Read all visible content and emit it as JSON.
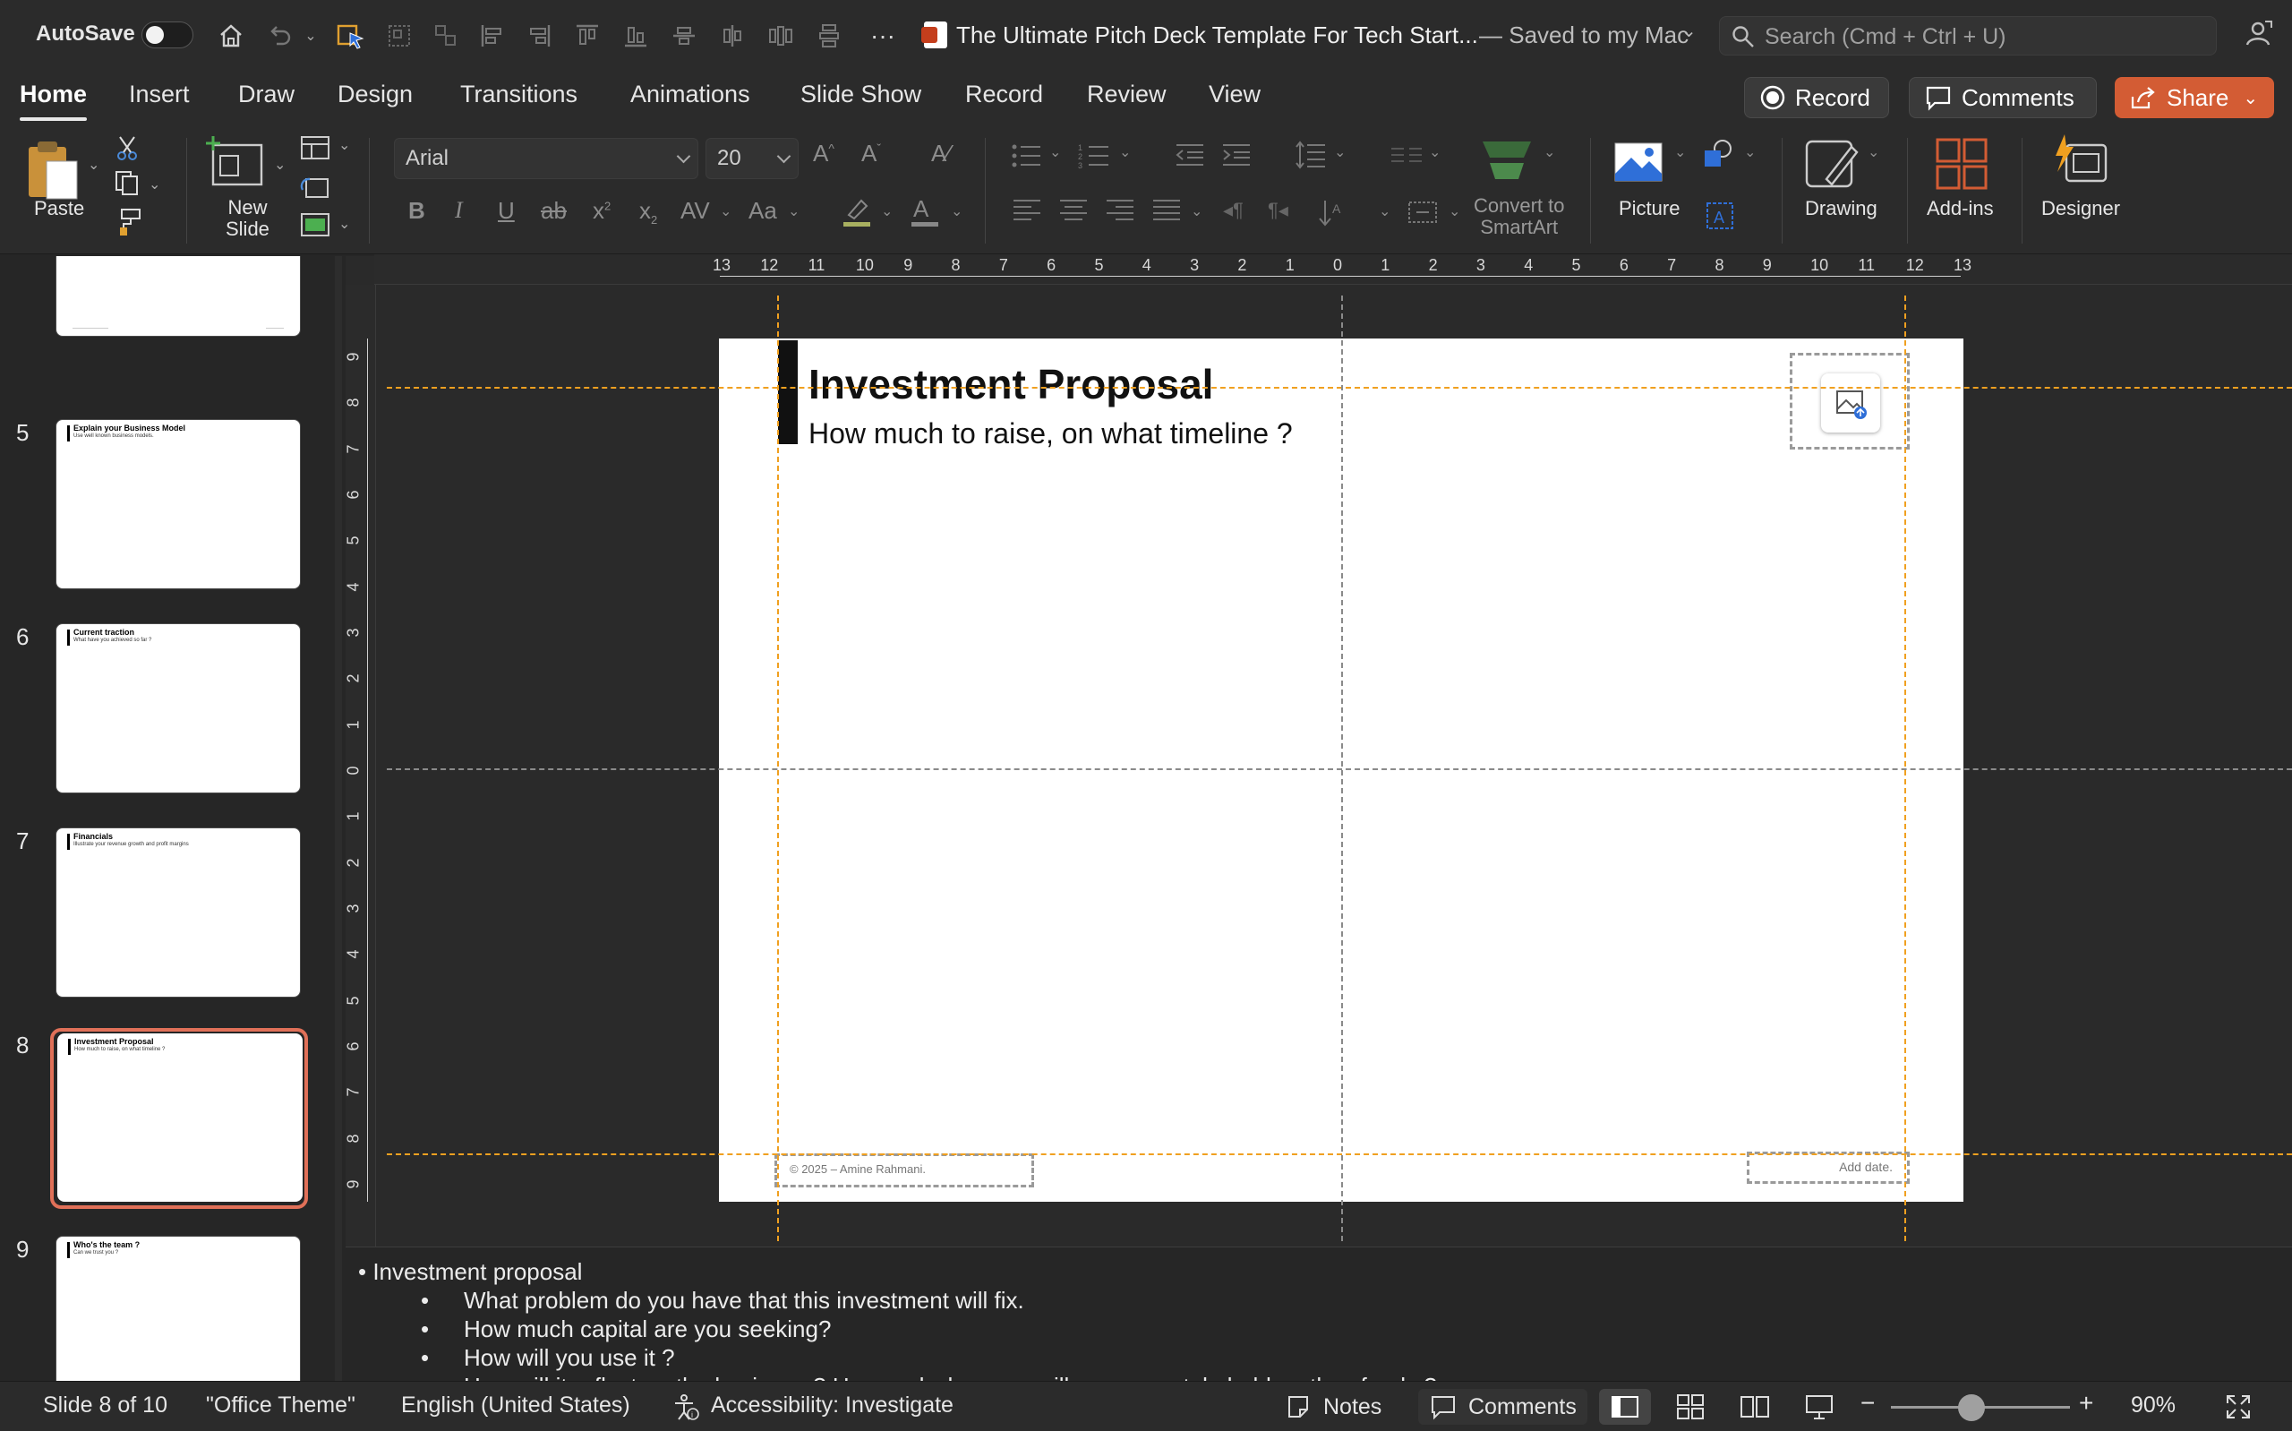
{
  "titlebar": {
    "autosave_label": "AutoSave",
    "autosave_state": "off",
    "doc_title": "The Ultimate Pitch Deck Template For Tech Start...",
    "save_status": "— Saved to my Mac",
    "search_placeholder": "Search (Cmd + Ctrl + U)"
  },
  "tabs": [
    "Home",
    "Insert",
    "Draw",
    "Design",
    "Transitions",
    "Animations",
    "Slide Show",
    "Record",
    "Review",
    "View"
  ],
  "active_tab": "Home",
  "actions": {
    "record": "Record",
    "comments": "Comments",
    "share": "Share"
  },
  "ribbon": {
    "paste": "Paste",
    "new_slide_1": "New",
    "new_slide_2": "Slide",
    "font_name": "Arial",
    "font_size": "20",
    "convert_1": "Convert to",
    "convert_2": "SmartArt",
    "picture": "Picture",
    "drawing": "Drawing",
    "addins": "Add-ins",
    "designer": "Designer"
  },
  "thumbnails": [
    {
      "num": "",
      "title": "",
      "sub": ""
    },
    {
      "num": "5",
      "title": "Explain your Business Model",
      "sub": "Use well known business models."
    },
    {
      "num": "6",
      "title": "Current traction",
      "sub": "What have you achieved so far ?"
    },
    {
      "num": "7",
      "title": "Financials",
      "sub": "Illustrate your revenue growth and profit margins"
    },
    {
      "num": "8",
      "title": "Investment Proposal",
      "sub": "How much to raise, on what timeline ?"
    },
    {
      "num": "9",
      "title": "Who's the team ?",
      "sub": "Can we trust you ?"
    }
  ],
  "selected_slide": "8",
  "slide": {
    "title": "Investment Proposal",
    "subtitle": "How much to raise, on what timeline ?",
    "footer": "© 2025 – Amine Rahmani.",
    "date": "Add date."
  },
  "ruler": {
    "h": [
      "13",
      "12",
      "11",
      "10",
      "9",
      "8",
      "7",
      "6",
      "5",
      "4",
      "3",
      "2",
      "1",
      "0",
      "1",
      "2",
      "3",
      "4",
      "5",
      "6",
      "7",
      "8",
      "9",
      "10",
      "11",
      "12",
      "13"
    ],
    "v": [
      "9",
      "8",
      "7",
      "6",
      "5",
      "4",
      "3",
      "2",
      "1",
      "0",
      "1",
      "2",
      "3",
      "4",
      "5",
      "6",
      "7",
      "8",
      "9"
    ]
  },
  "notes": {
    "heading": "• Investment proposal",
    "items": [
      "What problem do you have that this investment will fix.",
      "How much capital are you seeking?",
      "How will you use it ?",
      "How will it reflect on the business ? How and when you will pay your stakeholders they funds ?"
    ]
  },
  "status": {
    "slide": "Slide 8 of 10",
    "theme": "\"Office Theme\"",
    "language": "English (United States)",
    "accessibility": "Accessibility: Investigate",
    "notes": "Notes",
    "comments": "Comments",
    "zoom": "90%",
    "zoom_level": 0.45
  },
  "colors": {
    "accent": "#d35c34",
    "selection": "#e07058",
    "guide_orange": "#f0a020"
  }
}
